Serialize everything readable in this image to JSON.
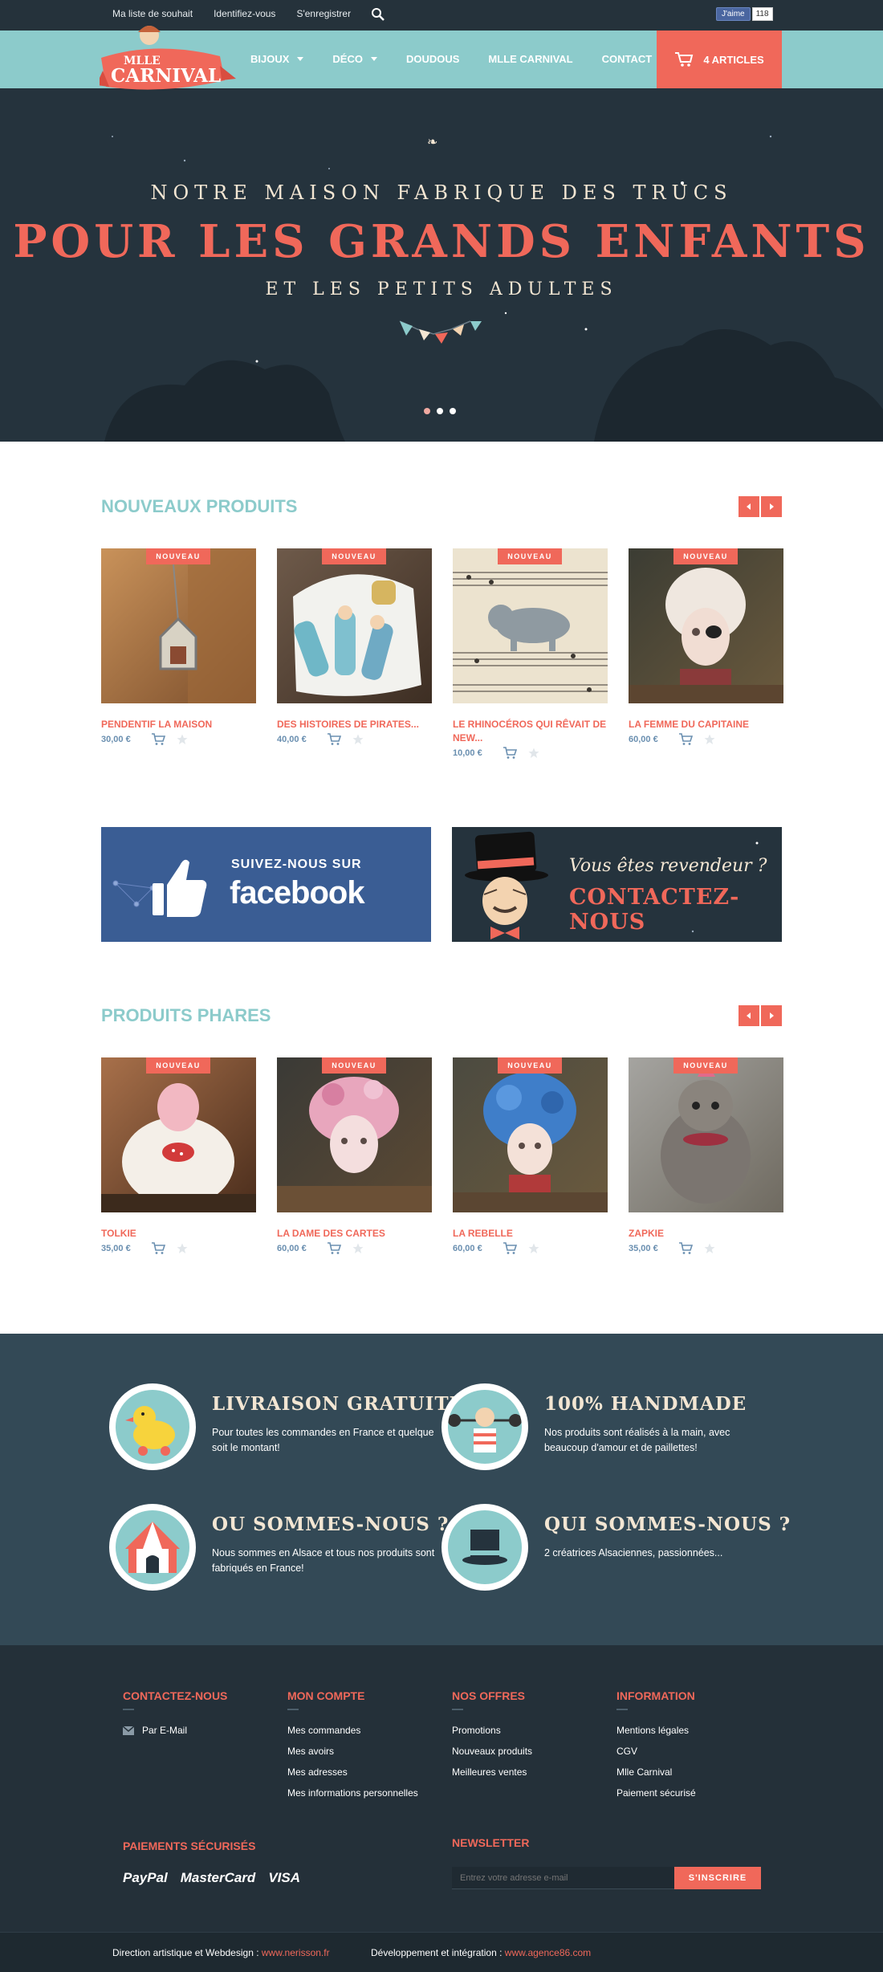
{
  "topbar": {
    "links": [
      "Ma liste de souhait",
      "Identifiez-vous",
      "S'enregistrer"
    ],
    "fb_like": "J'aime",
    "fb_count": "118"
  },
  "logo": {
    "line1": "MLLE",
    "line2": "CARNIVAL"
  },
  "nav": {
    "items": [
      {
        "label": "BIJOUX",
        "dropdown": true
      },
      {
        "label": "DÉCO",
        "dropdown": true
      },
      {
        "label": "DOUDOUS",
        "dropdown": false
      },
      {
        "label": "MLLE CARNIVAL",
        "dropdown": false
      },
      {
        "label": "CONTACT",
        "dropdown": false
      }
    ],
    "cart_label": "4 ARTICLES"
  },
  "hero": {
    "line1": "NOTRE MAISON FABRIQUE DES TRUCS",
    "line2": "POUR LES GRANDS ENFANTS",
    "line3": "ET LES PETITS ADULTES",
    "slides": 3,
    "active_slide": 1
  },
  "new_products": {
    "title": "NOUVEAUX PRODUITS",
    "items": [
      {
        "name": "PENDENTIF LA MAISON",
        "price": "30,00 €",
        "badge": "NOUVEAU"
      },
      {
        "name": "DES HISTOIRES DE PIRATES...",
        "price": "40,00 €",
        "badge": "NOUVEAU"
      },
      {
        "name": "LE RHINOCÉROS QUI RÊVAIT DE NEW...",
        "price": "10,00 €",
        "badge": "NOUVEAU"
      },
      {
        "name": "LA FEMME DU CAPITAINE",
        "price": "60,00 €",
        "badge": "NOUVEAU"
      }
    ]
  },
  "banners": {
    "facebook": {
      "line1": "SUIVEZ-NOUS SUR",
      "line2": "facebook"
    },
    "reseller": {
      "line1": "Vous êtes revendeur ?",
      "line2": "CONTACTEZ-NOUS"
    }
  },
  "featured_products": {
    "title": "PRODUITS PHARES",
    "items": [
      {
        "name": "TOLKIE",
        "price": "35,00 €",
        "badge": "NOUVEAU"
      },
      {
        "name": "LA DAME DES CARTES",
        "price": "60,00 €",
        "badge": "NOUVEAU"
      },
      {
        "name": "LA REBELLE",
        "price": "60,00 €",
        "badge": "NOUVEAU"
      },
      {
        "name": "ZAPKIE",
        "price": "35,00 €",
        "badge": "NOUVEAU"
      }
    ]
  },
  "features": [
    {
      "title": "LIVRAISON GRATUITE",
      "text": "Pour toutes les commandes en France et quelque soit le montant!",
      "icon": "duck-icon"
    },
    {
      "title": "100% HANDMADE",
      "text": "Nos produits sont réalisés à la main, avec beaucoup d'amour et de paillettes!",
      "icon": "strongman-icon"
    },
    {
      "title": "OU SOMMES-NOUS ?",
      "text": "Nous sommes en Alsace et tous nos produits sont fabriqués en France!",
      "icon": "circus-tent-icon"
    },
    {
      "title": "QUI SOMMES-NOUS ?",
      "text": "2 créatrices Alsaciennes, passionnées...",
      "icon": "top-hat-icon"
    }
  ],
  "footer": {
    "contact": {
      "title": "CONTACTEZ-NOUS",
      "email_label": "Par E-Mail"
    },
    "account": {
      "title": "MON COMPTE",
      "links": [
        "Mes commandes",
        "Mes avoirs",
        "Mes adresses",
        "Mes informations personnelles"
      ]
    },
    "offers": {
      "title": "NOS OFFRES",
      "links": [
        "Promotions",
        "Nouveaux produits",
        "Meilleures ventes"
      ]
    },
    "info": {
      "title": "INFORMATION",
      "links": [
        "Mentions légales",
        "CGV",
        "Mlle Carnival",
        "Paiement sécurisé"
      ]
    },
    "payments": {
      "title": "PAIEMENTS SÉCURISÉS",
      "logos": [
        "PayPal",
        "MasterCard",
        "VISA"
      ]
    },
    "newsletter": {
      "title": "NEWSLETTER",
      "placeholder": "Entrez votre adresse e-mail",
      "button": "S'INSCRIRE"
    }
  },
  "credits": {
    "design_label": "Direction artistique et Webdesign :",
    "design_link": "www.nerisson.fr",
    "dev_label": "Développement et intégration :",
    "dev_link": "www.agence86.com"
  },
  "colors": {
    "coral": "#f0685a",
    "teal": "#8ccbcb",
    "navy": "#25333d",
    "slate": "#334956"
  }
}
